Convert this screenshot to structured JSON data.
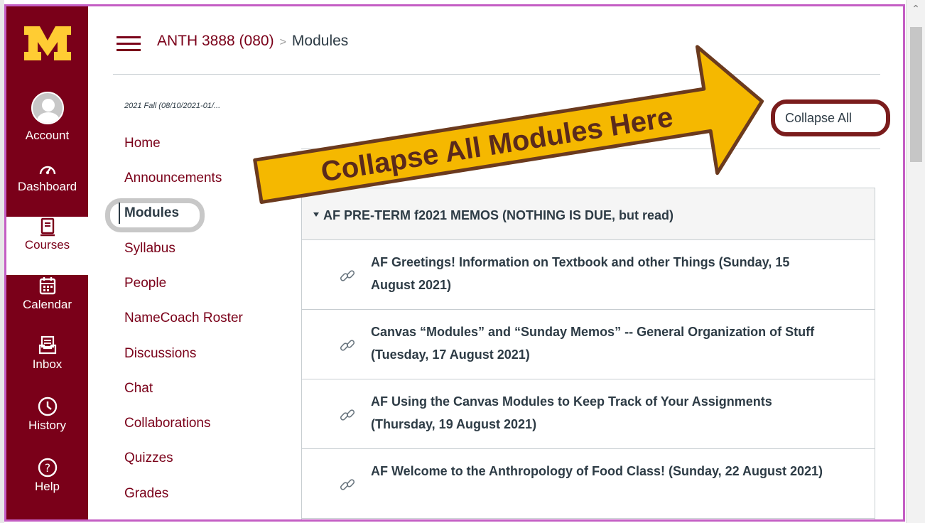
{
  "global_nav": {
    "items": [
      {
        "label": "Account",
        "icon": "avatar-icon",
        "active": false
      },
      {
        "label": "Dashboard",
        "icon": "dashboard-icon",
        "active": false
      },
      {
        "label": "Courses",
        "icon": "book-icon",
        "active": true
      },
      {
        "label": "Calendar",
        "icon": "calendar-icon",
        "active": false
      },
      {
        "label": "Inbox",
        "icon": "inbox-icon",
        "active": false
      },
      {
        "label": "History",
        "icon": "clock-icon",
        "active": false
      },
      {
        "label": "Help",
        "icon": "question-icon",
        "active": false
      }
    ],
    "brand_color": "#7a0019",
    "logo_color": "#ffcc33"
  },
  "header": {
    "course": "ANTH 3888 (080)",
    "separator": ">",
    "current": "Modules"
  },
  "course_nav": {
    "term": "2021 Fall (08/10/2021-01/...",
    "items": [
      {
        "label": "Home",
        "active": false
      },
      {
        "label": "Announcements",
        "active": false
      },
      {
        "label": "Modules",
        "active": true
      },
      {
        "label": "Syllabus",
        "active": false
      },
      {
        "label": "People",
        "active": false
      },
      {
        "label": "NameCoach Roster",
        "active": false
      },
      {
        "label": "Discussions",
        "active": false
      },
      {
        "label": "Chat",
        "active": false
      },
      {
        "label": "Collaborations",
        "active": false
      },
      {
        "label": "Quizzes",
        "active": false
      },
      {
        "label": "Grades",
        "active": false
      }
    ]
  },
  "toolbar": {
    "collapse_all": "Collapse All"
  },
  "annotation": {
    "arrow_text": "Collapse All Modules Here",
    "arrow_fill": "#f5b800",
    "arrow_stroke": "#6b3a1e"
  },
  "module": {
    "title": "AF PRE-TERM f2021 MEMOS (NOTHING IS DUE, but read)",
    "items": [
      {
        "title": "AF Greetings! Information on Textbook and other Things (Sunday, 15 August 2021)",
        "icon": "link-icon"
      },
      {
        "title": "Canvas “Modules” and “Sunday Memos” -- General Organization of Stuff (Tuesday, 17 August 2021)",
        "icon": "link-icon"
      },
      {
        "title": "AF Using the Canvas Modules to Keep Track of Your Assignments (Thursday, 19 August 2021)",
        "icon": "link-icon"
      },
      {
        "title": "AF Welcome to the Anthropology of Food Class! (Sunday, 22 August 2021)",
        "icon": "link-icon"
      }
    ]
  }
}
